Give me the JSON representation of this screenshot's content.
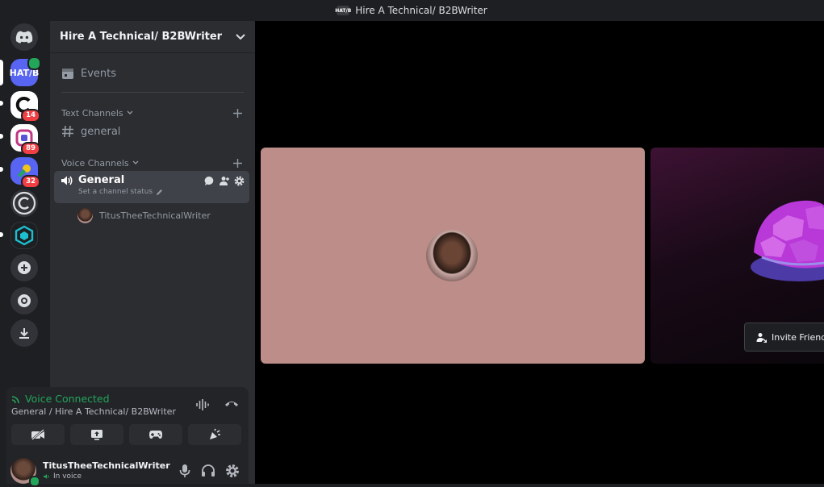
{
  "window": {
    "title": "Hire A Technical/ B2BWriter",
    "icon_text": "HAT/B"
  },
  "servers": [
    {
      "label": "HAT/B",
      "badge": "",
      "color": "#5865f2"
    },
    {
      "label": "",
      "badge": "14",
      "color": "#ffffff"
    },
    {
      "label": "",
      "badge": "89",
      "color": "#ffffff"
    },
    {
      "label": "",
      "badge": "32",
      "color": "#5865f2"
    },
    {
      "label": "",
      "badge": "",
      "color": "#313338"
    },
    {
      "label": "",
      "badge": "",
      "color": "#1e1f22"
    }
  ],
  "sidebar": {
    "server_name": "Hire A Technical/ B2BWriter",
    "events": "Events",
    "text_category": "Text Channels",
    "text_channels": [
      "general"
    ],
    "voice_category": "Voice Channels",
    "voice_channel": {
      "name": "General",
      "status": "Set a channel status"
    },
    "voice_members": [
      "TitusTheeTechnicalWriter"
    ]
  },
  "voice_panel": {
    "status": "Voice Connected",
    "location": "General / Hire A Technical/ B2BWriter"
  },
  "user": {
    "name": "TitusTheeTechnicalWriter",
    "status": "In voice"
  },
  "stage": {
    "invite_label": "Invite Friends"
  },
  "colors": {
    "accent": "#5865f2",
    "online": "#23a55a",
    "tile": "#bd8d89",
    "badge": "#f23f43"
  }
}
